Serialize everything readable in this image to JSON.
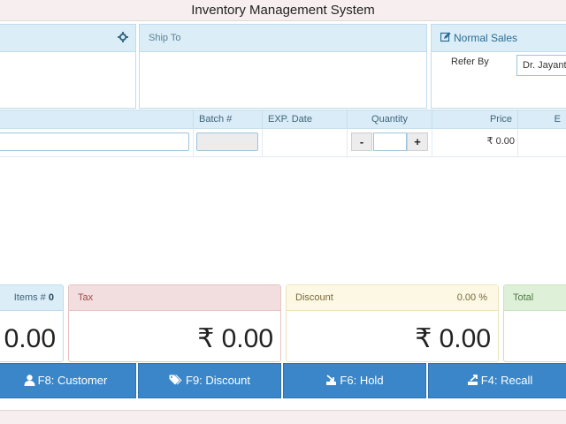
{
  "window": {
    "title": "Inventory Management System"
  },
  "customer_panel": {
    "icon": "gear-icon"
  },
  "ship_to": {
    "label": "Ship To"
  },
  "sales": {
    "type_label": "Normal Sales",
    "refer_by_label": "Refer By",
    "refer_by_value": "Dr. Jayant"
  },
  "grid": {
    "columns": [
      "Batch #",
      "EXP. Date",
      "Quantity",
      "Price",
      "E"
    ],
    "row": {
      "price": "₹ 0.00",
      "qty_minus": "-",
      "qty_plus": "+"
    }
  },
  "summary": {
    "items_label": "Items #",
    "items_count": "0",
    "items_total": "0.00",
    "tax_label": "Tax",
    "tax_value": "₹ 0.00",
    "discount_label": "Discount",
    "discount_pct": "0.00 %",
    "discount_value": "₹ 0.00",
    "total_label": "Total"
  },
  "buttons": {
    "customer": "F8: Customer",
    "discount": "F9: Discount",
    "hold": "F6: Hold",
    "recall": "F4: Recall"
  },
  "colors": {
    "primary_button": "#3a86c8",
    "header_blue": "#dbeef8",
    "tax_red": "#f2dede",
    "discount_yellow": "#fcf8e3",
    "total_green": "#dff0d8"
  }
}
